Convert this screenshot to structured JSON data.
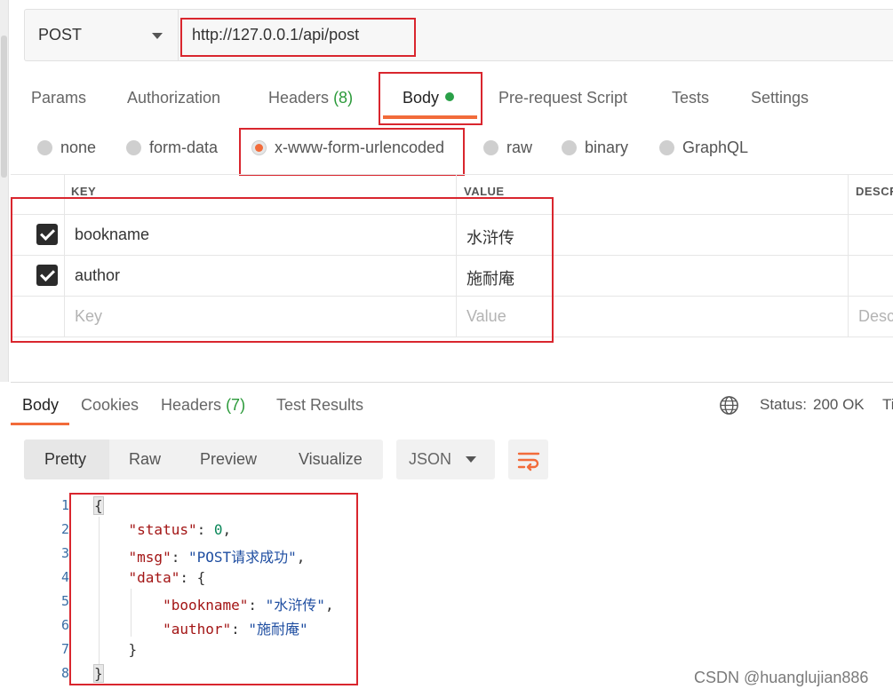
{
  "request": {
    "method": "POST",
    "url": "http://127.0.0.1/api/post"
  },
  "request_tabs": [
    {
      "label": "Params"
    },
    {
      "label": "Authorization"
    },
    {
      "label": "Headers",
      "count": "(8)"
    },
    {
      "label": "Body"
    },
    {
      "label": "Pre-request Script"
    },
    {
      "label": "Tests"
    },
    {
      "label": "Settings"
    }
  ],
  "body_types": [
    "none",
    "form-data",
    "x-www-form-urlencoded",
    "raw",
    "binary",
    "GraphQL"
  ],
  "body_type_selected": "x-www-form-urlencoded",
  "params_table": {
    "headers": [
      "KEY",
      "VALUE",
      "DESCR"
    ],
    "rows": [
      {
        "key": "bookname",
        "value": "水浒传",
        "checked": true
      },
      {
        "key": "author",
        "value": "施耐庵",
        "checked": true
      }
    ],
    "placeholders": {
      "key": "Key",
      "value": "Value",
      "description": "Desc"
    }
  },
  "response": {
    "tabs": [
      {
        "label": "Body"
      },
      {
        "label": "Cookies"
      },
      {
        "label": "Headers",
        "count": "(7)"
      },
      {
        "label": "Test Results"
      }
    ],
    "status_label": "Status:",
    "status_value": "200 OK",
    "time_label": "Ti",
    "view_modes": [
      "Pretty",
      "Raw",
      "Preview",
      "Visualize"
    ],
    "format": "JSON",
    "code": {
      "line_numbers": [
        "1",
        "2",
        "3",
        "4",
        "5",
        "6",
        "7",
        "8"
      ],
      "status_key": "\"status\"",
      "status_val": "0",
      "msg_key": "\"msg\"",
      "msg_val": "\"POST请求成功\"",
      "data_key": "\"data\"",
      "bookname_key": "\"bookname\"",
      "bookname_val": "\"水浒传\"",
      "author_key": "\"author\"",
      "author_val": "\"施耐庵\""
    }
  },
  "watermark": "CSDN @huanglujian886",
  "colors": {
    "accent": "#f26b3a",
    "highlight_box": "#d9262e",
    "success": "#2b9a3a"
  }
}
